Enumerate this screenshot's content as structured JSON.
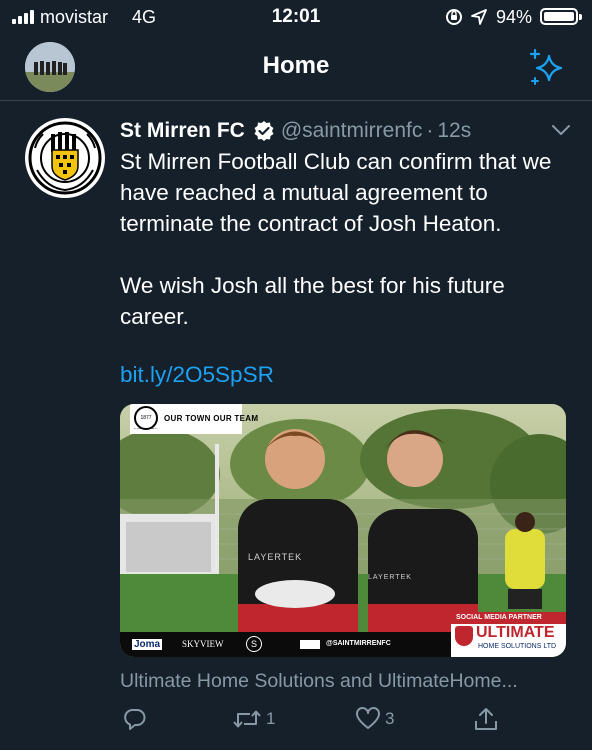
{
  "status_bar": {
    "carrier": "movistar",
    "network": "4G",
    "time": "12:01",
    "battery": "94%",
    "battery_level": 0.94
  },
  "header": {
    "title": "Home"
  },
  "tweet": {
    "author_name": "St Mirren FC",
    "handle": "@saintmirrenfc",
    "dot": "·",
    "time_ago": "12s",
    "text_p1": "St Mirren Football Club can confirm that we have reached a mutual agreement to terminate the contract of Josh Heaton.",
    "text_p2": "We wish Josh all the best for his future career.",
    "link": "bit.ly/2O5SpSR",
    "card_caption": "Ultimate Home Solutions and UltimateHome...",
    "media": {
      "logo_year": "1877",
      "logo_text": "ST MIRREN FOOTBALL CLUB",
      "tagline": "OUR TOWN OUR TEAM",
      "shirt_text": "LAYERTEK",
      "shirt_text2": "LAYERTEK",
      "sponsor_1": "Joma",
      "sponsor_2": "SKYVIEW",
      "sponsor_3": "S",
      "social_handle": "@SAINTMIRRENFC",
      "partner_label": "SOCIAL MEDIA PARTNER",
      "partner_name": "ULTIMATE",
      "partner_sub": "HOME SOLUTIONS LTD"
    },
    "actions": {
      "reply_count": "",
      "retweet_count": "1",
      "like_count": "3"
    }
  },
  "colors": {
    "background": "#15202b",
    "accent": "#1da1f2",
    "secondary_text": "#8899a6",
    "divider": "#38444d"
  }
}
